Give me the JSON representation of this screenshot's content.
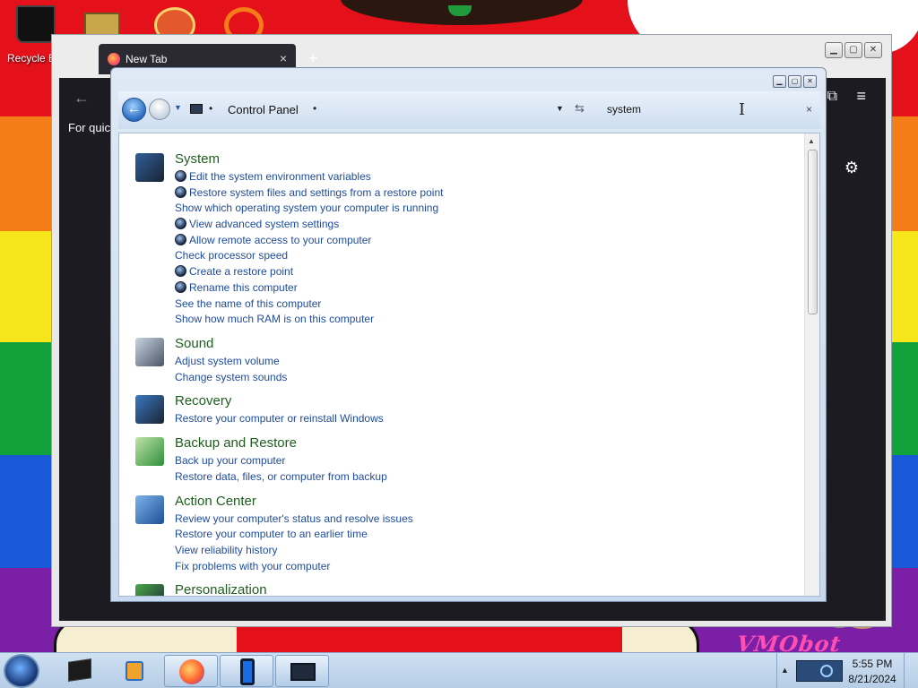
{
  "desktop": {
    "recycle_bin_label": "Recycle B",
    "watermark": "VMObot"
  },
  "firefox": {
    "tab_title": "New Tab",
    "tab_close": "×",
    "new_tab": "+",
    "quick_text": "For quick",
    "back": "←",
    "menu": "≡",
    "gear": "⚙",
    "ext": "⧉"
  },
  "control_panel": {
    "breadcrumb": "Control Panel",
    "search_value": "system",
    "search_clear": "×",
    "sections": [
      {
        "title": "System",
        "icon": "monitor-icon",
        "links": [
          {
            "text": "Edit the system environment variables",
            "shield": true
          },
          {
            "text": "Restore system files and settings from a restore point",
            "shield": true
          },
          {
            "text": "Show which operating system your computer is running",
            "shield": false
          },
          {
            "text": "View advanced system settings",
            "shield": true
          },
          {
            "text": "Allow remote access to your computer",
            "shield": true
          },
          {
            "text": "Check processor speed",
            "shield": false
          },
          {
            "text": "Create a restore point",
            "shield": true
          },
          {
            "text": "Rename this computer",
            "shield": true
          },
          {
            "text": "See the name of this computer",
            "shield": false
          },
          {
            "text": "Show how much RAM is on this computer",
            "shield": false
          }
        ]
      },
      {
        "title": "Sound",
        "icon": "speaker-icon",
        "links": [
          {
            "text": "Adjust system volume",
            "shield": false
          },
          {
            "text": "Change system sounds",
            "shield": false
          }
        ]
      },
      {
        "title": "Recovery",
        "icon": "recovery-icon",
        "links": [
          {
            "text": "Restore your computer or reinstall Windows",
            "shield": false
          }
        ]
      },
      {
        "title": "Backup and Restore",
        "icon": "backup-icon",
        "links": [
          {
            "text": "Back up your computer",
            "shield": false
          },
          {
            "text": "Restore data, files, or computer from backup",
            "shield": false
          }
        ]
      },
      {
        "title": "Action Center",
        "icon": "action-center-flag-icon",
        "links": [
          {
            "text": "Review your computer's status and resolve issues",
            "shield": false
          },
          {
            "text": "Restore your computer to an earlier time",
            "shield": false
          },
          {
            "text": "View reliability history",
            "shield": false
          },
          {
            "text": "Fix problems with your computer",
            "shield": false
          }
        ]
      },
      {
        "title": "Personalization",
        "icon": "personalization-icon",
        "links": []
      }
    ]
  },
  "taskbar": {
    "time": "5:55 PM",
    "date": "8/21/2024"
  },
  "colors": {
    "link": "#1e4b9e",
    "section_title": "#1e5d1e"
  }
}
